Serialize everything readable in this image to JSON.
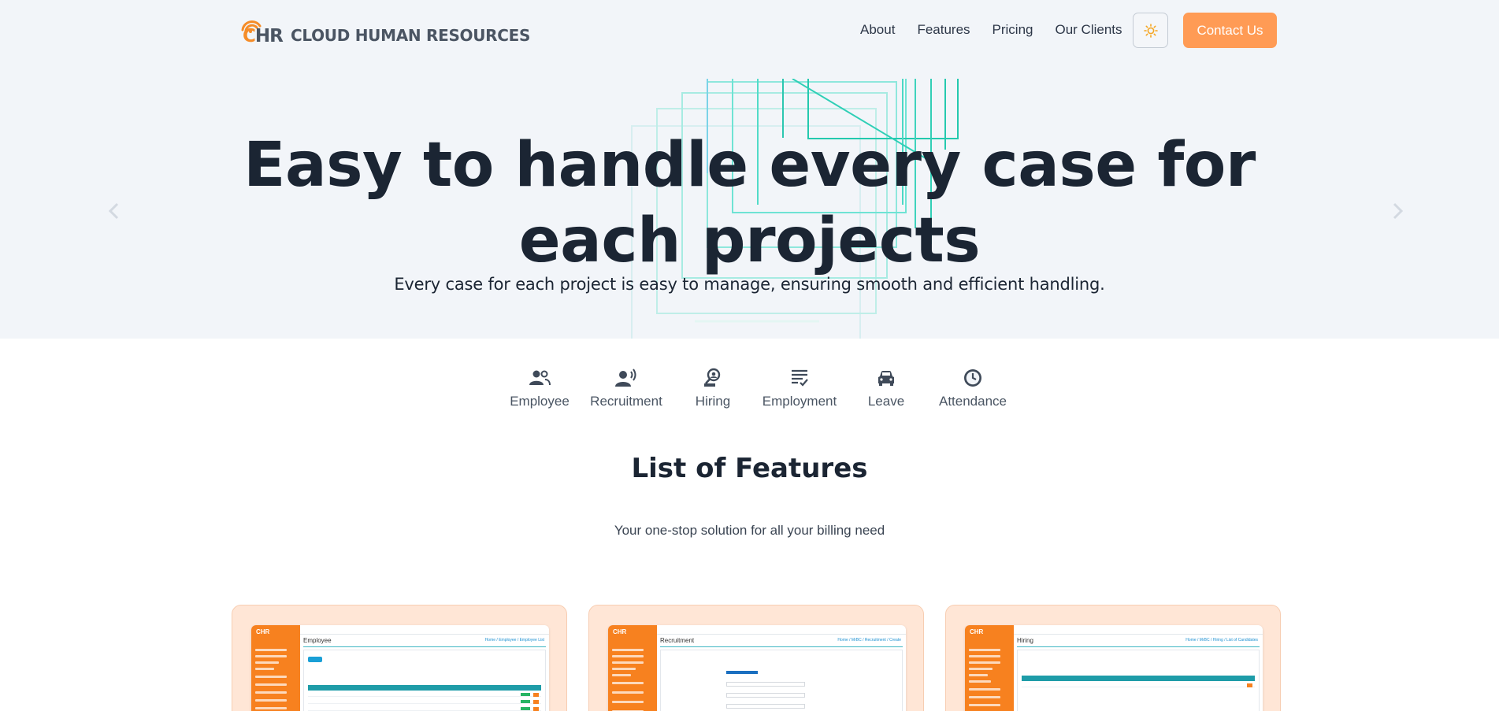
{
  "brand": {
    "logo_mark": "CHR",
    "name": "CLOUD HUMAN RESOURCES",
    "colors": {
      "accent": "#f58c28",
      "button": "#ff9b55",
      "dark_text": "#1b2533",
      "hero_bg": "#f2f5f9",
      "teal": "#2ec4b6"
    }
  },
  "nav": {
    "links": [
      "About",
      "Features",
      "Pricing",
      "Our Clients"
    ],
    "theme_toggle_icon": "sun-icon",
    "contact_label": "Contact Us"
  },
  "hero": {
    "title": "Easy to handle every case for each projects",
    "subtitle": "Every case for each project is easy to manage, ensuring smooth and efficient handling."
  },
  "categories": [
    {
      "label": "Employee",
      "icon": "users-icon"
    },
    {
      "label": "Recruitment",
      "icon": "speaking-person-icon"
    },
    {
      "label": "Hiring",
      "icon": "person-search-icon"
    },
    {
      "label": "Employment",
      "icon": "list-check-icon"
    },
    {
      "label": "Leave",
      "icon": "car-icon"
    },
    {
      "label": "Attendance",
      "icon": "clock-icon"
    }
  ],
  "features": {
    "title": "List of Features",
    "subtitle": "Your one-stop solution for all your billing need"
  },
  "cards": [
    {
      "screen_title": "Employee",
      "breadcrumb": "Home / Employee / Employee List"
    },
    {
      "screen_title": "Recruitment",
      "breadcrumb": "Home / MrBC / Recruitment / Create"
    },
    {
      "screen_title": "Hiring",
      "breadcrumb": "Home / MrBC / Hiring / List of Candidates"
    }
  ]
}
